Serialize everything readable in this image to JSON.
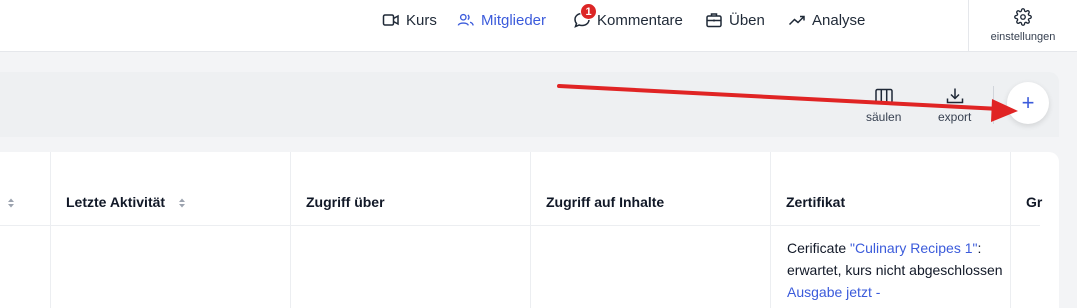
{
  "nav": {
    "items": [
      {
        "label": "Kurs",
        "icon": "video-icon"
      },
      {
        "label": "Mitglieder",
        "icon": "users-icon",
        "active": true
      },
      {
        "label": "Kommentare",
        "icon": "comment-icon",
        "badge": "1"
      },
      {
        "label": "Üben",
        "icon": "briefcase-icon"
      },
      {
        "label": "Analyse",
        "icon": "trend-icon"
      }
    ],
    "settings_label": "einstellungen"
  },
  "toolbar": {
    "columns_label": "säulen",
    "export_label": "export",
    "add_label": "+"
  },
  "table": {
    "headers": [
      "Letzte Aktivität",
      "Zugriff über",
      "Zugriff auf Inhalte",
      "Zertifikat",
      "Gr"
    ],
    "certificate_cell": {
      "prefix": "Cerificate ",
      "course_link": "\"Culinary Recipes 1\"",
      "suffix": ": erwartet, kurs nicht abgeschlossen ",
      "action_link": "Ausgabe jetzt -"
    }
  },
  "colors": {
    "accent": "#3b5bdb",
    "badge": "#dc2626",
    "arrow": "#e02424"
  }
}
